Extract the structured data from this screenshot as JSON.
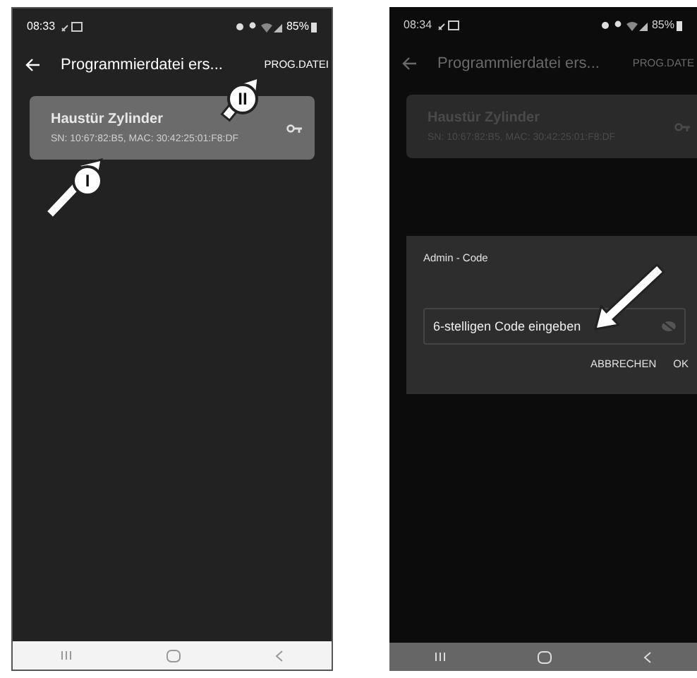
{
  "screens": [
    {
      "dimmed": false,
      "status_bar": {
        "time": "08:33",
        "battery": "85%"
      },
      "app_bar": {
        "title": "Programmierdatei ers...",
        "action": "PROG.DATEI"
      },
      "device": {
        "name": "Haustür Zylinder",
        "details": "SN: 10:67:82:B5, MAC: 30:42:25:01:F8:DF"
      },
      "callouts": [
        {
          "label": "I"
        },
        {
          "label": "II"
        }
      ]
    },
    {
      "dimmed": true,
      "status_bar": {
        "time": "08:34",
        "battery": "85%"
      },
      "app_bar": {
        "title": "Programmierdatei ers...",
        "action": "PROG.DATE"
      },
      "device": {
        "name": "Haustür Zylinder",
        "details": "SN: 10:67:82:B5, MAC: 30:42:25:01:F8:DF"
      },
      "dialog": {
        "title": "Admin - Code",
        "field": {
          "placeholder": "6-stelligen Code eingeben"
        },
        "buttons": [
          "ABBRECHEN",
          "OK"
        ]
      }
    }
  ]
}
